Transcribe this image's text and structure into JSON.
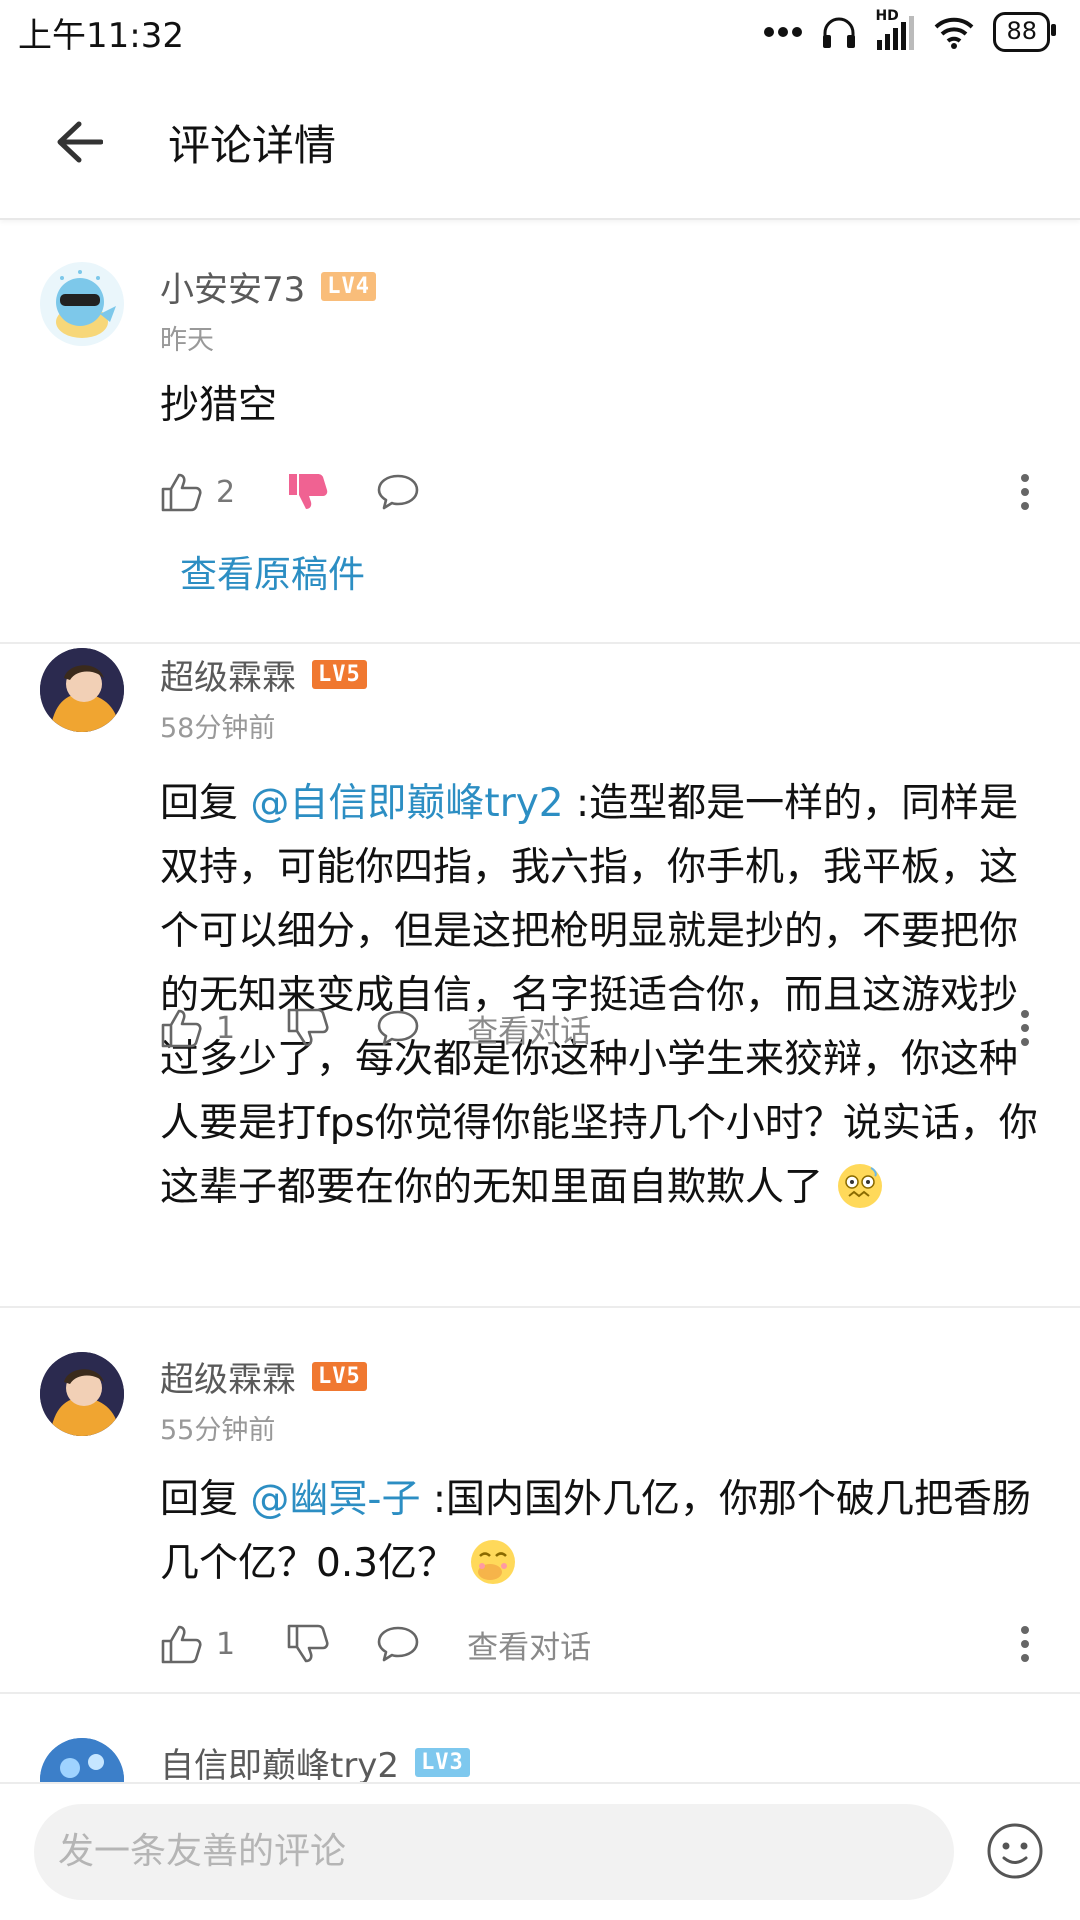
{
  "status": {
    "time": "上午11:32",
    "battery": "88",
    "hd": "HD"
  },
  "header": {
    "title": "评论详情"
  },
  "comments": [
    {
      "username": "小安安73",
      "level": "LV4",
      "level_color": "#f9bd7a",
      "time": "昨天",
      "text": "抄猎空",
      "likes": "2",
      "view_original": "查看原稿件"
    },
    {
      "username": "超级霖霖",
      "level": "LV5",
      "level_color": "#f07830",
      "time": "58分钟前",
      "reply_prefix": "回复 ",
      "mention": "@自信即巅峰try2",
      "text": " :造型都是一样的，同样是双持，可能你四指，我六指，你手机，我平板，这个可以细分，但是这把枪明显就是抄的，不要把你的无知来变成自信，名字挺适合你，而且这游戏抄过多少了，每次都是你这种小学生来狡辩，你这种人要是打fps你觉得你能坚持几个小时？说实话，你这辈子都要在你的无知里面自欺欺人了",
      "likes": "1",
      "view_convo": "查看对话"
    },
    {
      "username": "超级霖霖",
      "level": "LV5",
      "level_color": "#f07830",
      "time": "55分钟前",
      "reply_prefix": "回复 ",
      "mention": "@幽冥-子",
      "text": " :国内国外几亿，你那个破几把香肠几个亿？0.3亿？",
      "likes": "1",
      "view_convo": "查看对话"
    },
    {
      "username": "自信即巅峰try2",
      "level": "LV3",
      "level_color": "#7ec8ee"
    }
  ],
  "bottom": {
    "placeholder": "发一条友善的评论"
  },
  "colors": {
    "accent": "#2c8ec3",
    "dislike_active": "#f06292"
  }
}
